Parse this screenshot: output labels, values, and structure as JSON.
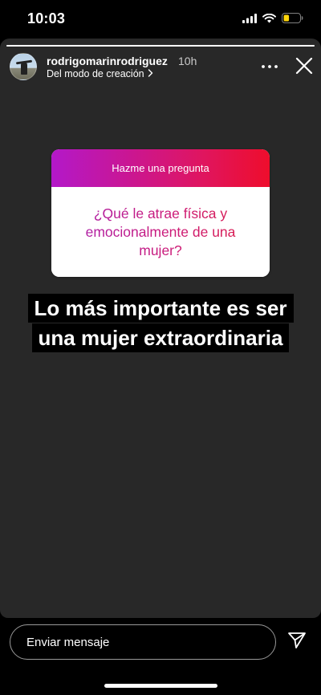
{
  "status_bar": {
    "time": "10:03",
    "icons": [
      "signal-icon",
      "wifi-icon",
      "battery-icon"
    ],
    "battery_level": 0.35,
    "battery_color": "#ffd60a"
  },
  "story": {
    "progress": 1.0,
    "author": {
      "username": "rodrigomarinrodriguez",
      "time_ago": "10h",
      "subtitle": "Del modo de creación"
    },
    "sticker": {
      "header": "Hazme una pregunta",
      "question": "¿Qué le atrae física y emocionalmente de una mujer?"
    },
    "answer": "Lo más importante es ser una mujer extraordinaria"
  },
  "composer": {
    "placeholder": "Enviar mensaje"
  },
  "colors": {
    "story_background": "#282828",
    "sticker_gradient_start": "#b318c9",
    "sticker_gradient_end": "#ee0d2c"
  }
}
